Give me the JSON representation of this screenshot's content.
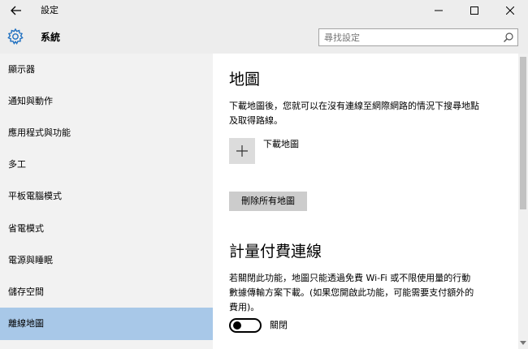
{
  "window": {
    "title": "設定"
  },
  "header": {
    "section_title": "系統",
    "search": {
      "placeholder": "尋找設定",
      "value": ""
    }
  },
  "sidebar": {
    "items": [
      {
        "label": "顯示器",
        "selected": false
      },
      {
        "label": "通知與動作",
        "selected": false
      },
      {
        "label": "應用程式與功能",
        "selected": false
      },
      {
        "label": "多工",
        "selected": false
      },
      {
        "label": "平板電腦模式",
        "selected": false
      },
      {
        "label": "省電模式",
        "selected": false
      },
      {
        "label": "電源與睡眠",
        "selected": false
      },
      {
        "label": "儲存空間",
        "selected": false
      },
      {
        "label": "離線地圖",
        "selected": true
      }
    ]
  },
  "content": {
    "maps": {
      "heading": "地圖",
      "description_line1": "下載地圖後，您就可以在沒有連線至網際網路的情況下搜尋地點",
      "description_line2": "及取得路線。",
      "download_label": "下載地圖",
      "delete_all_label": "刪除所有地圖"
    },
    "metered": {
      "heading": "計量付費連線",
      "description_line1": "若關閉此功能，地圖只能透過免費 Wi-Fi 或不限使用量的行動",
      "description_line2": "數據傳輸方案下載。(如果您開啟此功能，可能需要支付額外的",
      "description_line3": "費用)。",
      "toggle_label": "關閉",
      "toggle_on": false
    }
  },
  "colors": {
    "titlebar_bg": "#ededed",
    "sidebar_bg": "#f2f2f2",
    "selected_bg": "#a8c8e8",
    "accent": "#1e6fc0"
  }
}
